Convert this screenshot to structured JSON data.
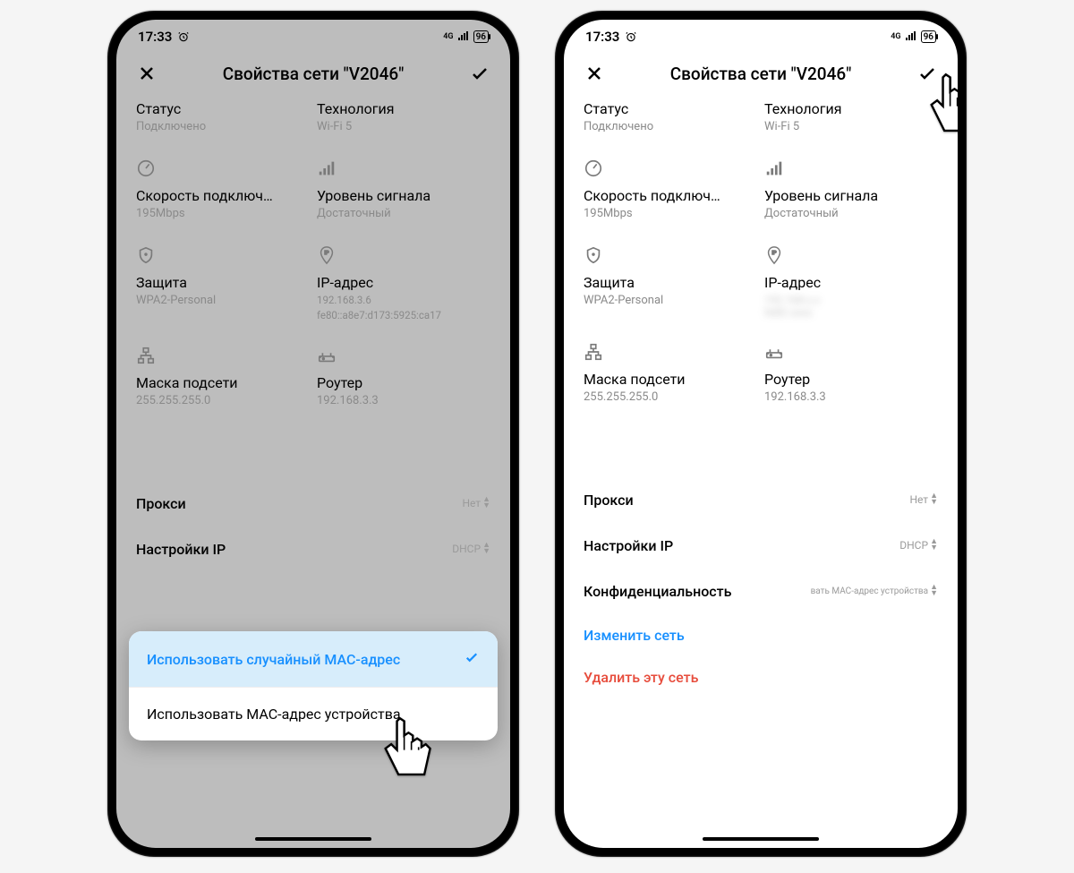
{
  "statusbar": {
    "time": "17:33",
    "network_label": "4G",
    "battery": "96"
  },
  "header": {
    "title": "Свойства сети \"V2046\""
  },
  "fields": {
    "status_label": "Статус",
    "status_value": "Подключено",
    "tech_label": "Технология",
    "tech_value": "Wi-Fi 5",
    "speed_label": "Скорость подключ…",
    "speed_value": "195Mbps",
    "signal_label": "Уровень сигнала",
    "signal_value": "Достаточный",
    "security_label": "Защита",
    "security_value": "WPA2-Personal",
    "ip_label": "IP-адрес",
    "ip_value_line1": "192.168.3.6",
    "ip_value_line2": "fe80::a8e7:d173:5925:ca17",
    "subnet_label": "Маска подсети",
    "subnet_value": "255.255.255.0",
    "router_label": "Роутер",
    "router_value": "192.168.3.3"
  },
  "rows": {
    "proxy_label": "Прокси",
    "proxy_value": "Нет",
    "ip_settings_label": "Настройки IP",
    "ip_settings_value": "DHCP",
    "privacy_label": "Конфиденциальность",
    "privacy_value": "вать MAC-адрес устройства"
  },
  "actions": {
    "modify": "Изменить сеть",
    "delete": "Удалить эту сеть"
  },
  "dropdown": {
    "opt1": "Использовать случайный МАС-адрес",
    "opt2": "Использовать МАС-адрес устройства"
  }
}
